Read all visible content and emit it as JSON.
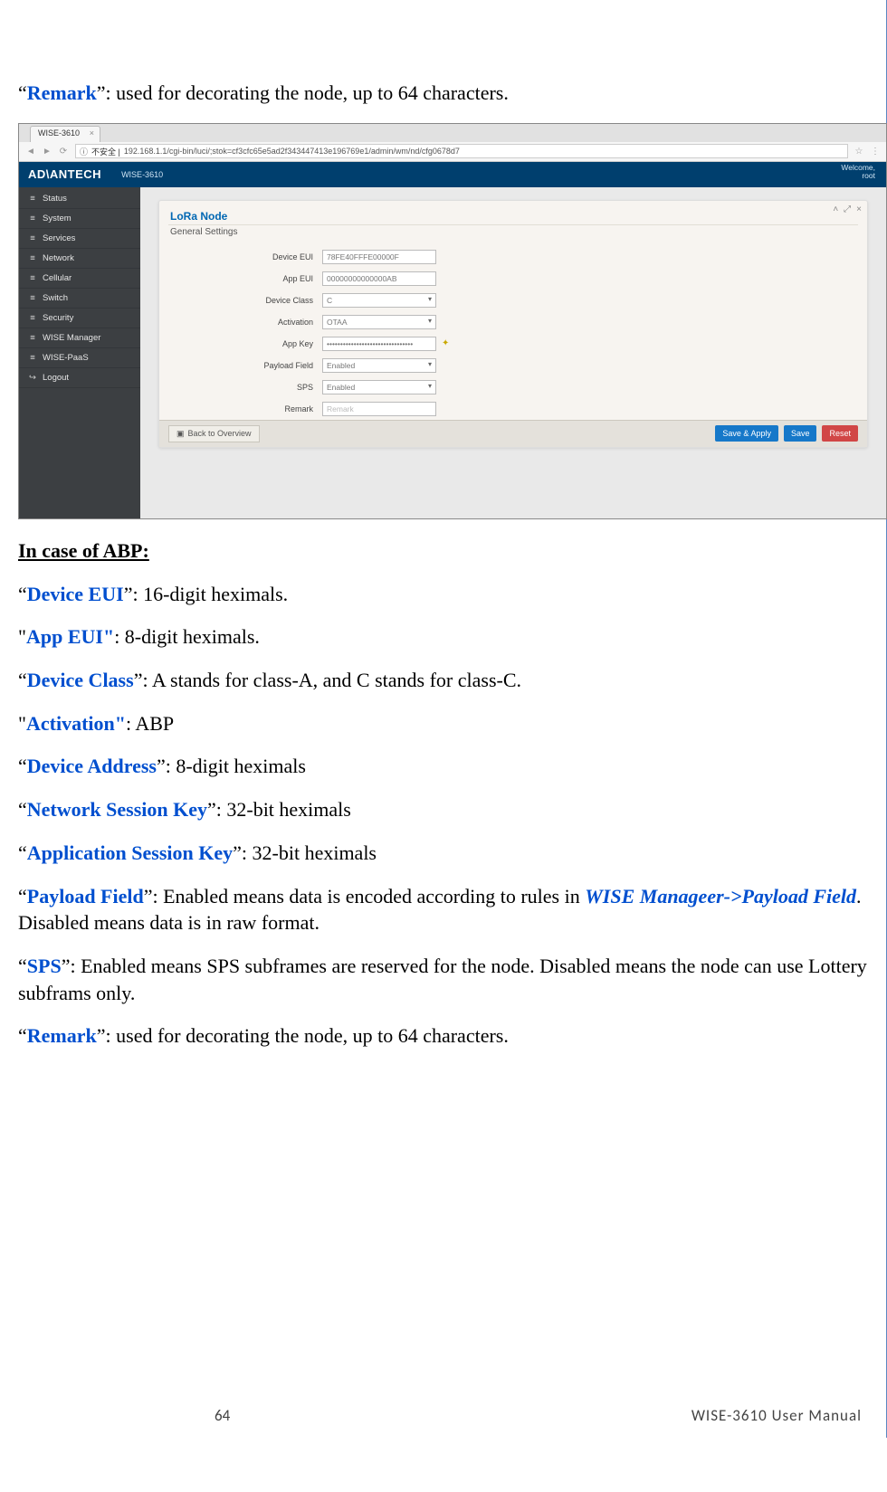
{
  "intro": {
    "remark_term": "Remark",
    "remark_desc": ": used for decorating the node, up to 64 characters."
  },
  "screenshot": {
    "tab_title": "WISE-3610",
    "url_prefix": "不安全 |",
    "url": "192.168.1.1/cgi-bin/luci/;stok=cf3cfc65e5ad2f343447413e196769e1/admin/wm/nd/cfg0678d7",
    "brand": "AD\\ANTECH",
    "product": "WISE-3610",
    "welcome_line1": "Welcome,",
    "welcome_line2": "root",
    "sidebar": [
      {
        "icon": "≡",
        "label": "Status"
      },
      {
        "icon": "≡",
        "label": "System"
      },
      {
        "icon": "≡",
        "label": "Services"
      },
      {
        "icon": "≡",
        "label": "Network"
      },
      {
        "icon": "≡",
        "label": "Cellular"
      },
      {
        "icon": "≡",
        "label": "Switch"
      },
      {
        "icon": "≡",
        "label": "Security"
      },
      {
        "icon": "≡",
        "label": "WISE Manager"
      },
      {
        "icon": "≡",
        "label": "WISE-PaaS"
      },
      {
        "icon": "↪",
        "label": "Logout"
      }
    ],
    "panel_title": "LoRa Node",
    "panel_subtitle": "General Settings",
    "fields": {
      "device_eui_label": "Device EUI",
      "device_eui_value": "78FE40FFFE00000F",
      "app_eui_label": "App EUI",
      "app_eui_value": "00000000000000AB",
      "device_class_label": "Device Class",
      "device_class_value": "C",
      "activation_label": "Activation",
      "activation_value": "OTAA",
      "app_key_label": "App Key",
      "app_key_value": "••••••••••••••••••••••••••••••••",
      "payload_label": "Payload Field",
      "payload_value": "Enabled",
      "sps_label": "SPS",
      "sps_value": "Enabled",
      "remark_label": "Remark",
      "remark_placeholder": "Remark"
    },
    "buttons": {
      "back": "Back to Overview",
      "save_apply": "Save & Apply",
      "save": "Save",
      "reset": "Reset"
    }
  },
  "abp": {
    "heading": "In case of ABP:",
    "items": [
      {
        "term": "Device EUI",
        "desc": ": 16-digit heximals."
      },
      {
        "term": "App EUI\"",
        "pre": "\"",
        "desc": ": 8-digit heximals."
      },
      {
        "term": "Device Class",
        "desc": ": A stands for class-A, and C stands for class-C."
      },
      {
        "term": "Activation\"",
        "pre": "\"",
        "desc": ": ABP"
      },
      {
        "term": "Device Address",
        "desc": ": 8-digit heximals"
      },
      {
        "term": "Network Session Key",
        "desc": ": 32-bit heximals"
      },
      {
        "term": "Application Session Key",
        "desc": ": 32-bit heximals"
      }
    ],
    "payload_term": "Payload Field",
    "payload_desc1": ": Enabled means data is encoded according to rules in ",
    "payload_emph": "WISE Manageer->Payload Field",
    "payload_desc2": ". Disabled means data is in raw format.",
    "sps_term": "SPS",
    "sps_desc": ": Enabled means SPS subframes are reserved for the node. Disabled means the node can use Lottery subframs only.",
    "remark_term": "Remark",
    "remark_desc": ": used for decorating the node, up to 64 characters."
  },
  "footer": {
    "page": "64",
    "doc": "WISE-3610  User  Manual"
  }
}
